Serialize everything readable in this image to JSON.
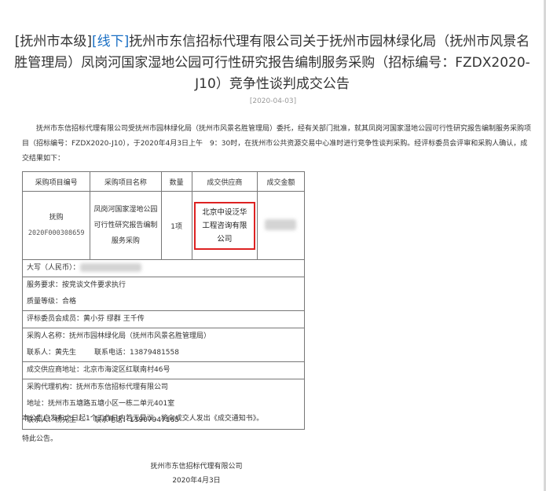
{
  "title": {
    "prefix": "[抚州市本级]",
    "link": "[线下]",
    "text": "抚州市东信招标代理有限公司关于抚州市园林绿化局（抚州市风景名胜管理局）凤岗河国家湿地公园可行性研究报告编制服务采购（招标编号：FZDX2020-J10）竞争性谈判成交公告"
  },
  "date": "[2020-04-03]",
  "intro": "抚州市东信招标代理有限公司受抚州市园林绿化局（抚州市风景名胜管理局）委托，经有关部门批准，就其凤岗河国家湿地公园可行性研究报告编制服务采购项目（招标编号：FZDX2020-J10），于2020年4月3日上午　9：30时，在抚州市公共资源交易中心准时进行竞争性谈判采购。经评标委员会评审和采购人确认，成交结果如下：",
  "table": {
    "headers": [
      "采购项目编号",
      "采购项目名称",
      "数量",
      "成交供应商",
      "成交金额"
    ],
    "row": {
      "code_line1": "抚购",
      "code_line2": "2020F000308659",
      "name": "凤岗河国家湿地公园可行性研究报告编制服务采购",
      "qty": "1项",
      "supplier": "北京中设泛华工程咨询有限公司"
    },
    "amount_label": "大写（人民币）：",
    "service_req": "服务要求：按竞谈文件要求执行",
    "quality": "质量等级：合格",
    "committee": "评标委员会成员：黄小芬  缪群  王千传",
    "purchaser": "采购人名称：抚州市园林绿化局（抚州市风景名胜管理局）",
    "purchaser_contact": "联系人：黄先生",
    "purchaser_phone": "联系电话：13879481558",
    "supplier_address": "成交供应商地址：北京市海淀区红联南村46号",
    "agency": "采购代理机构：抚州市东信招标代理有限公司",
    "agency_address": "地址：抚州市五塘路五塘小区一栋二单元401室",
    "agency_contact": "联系人：杨先生",
    "agency_phone": "联系电话：13907947165"
  },
  "footer": {
    "notice": "本公告自发布之日起1个工作日内若无异议，将向成交人发出《成交通知书》。",
    "closing": "特此公告。"
  },
  "signature": {
    "company": "抚州市东信招标代理有限公司",
    "date": "2020年4月3日"
  }
}
